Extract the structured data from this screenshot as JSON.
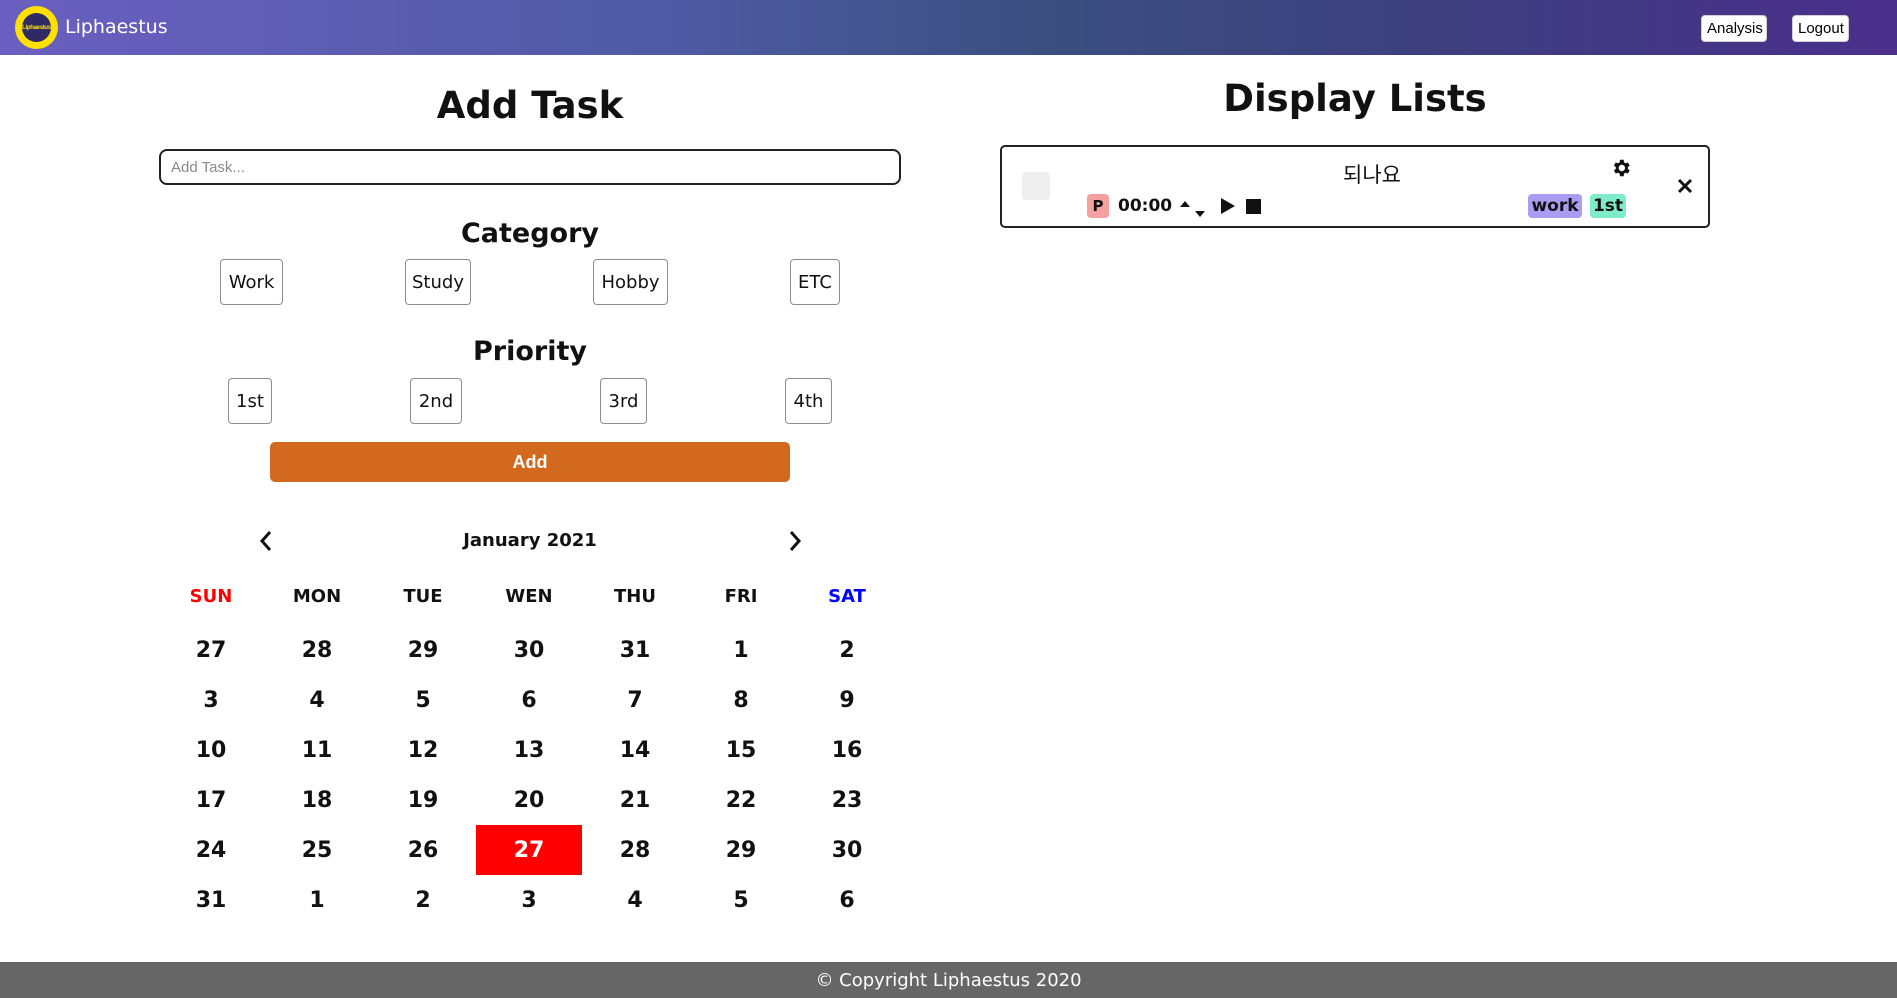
{
  "header": {
    "logo_text": "Liphaestus",
    "brand": "Liphaestus",
    "analysis_label": "Analysis",
    "logout_label": "Logout"
  },
  "add_task": {
    "title": "Add Task",
    "input_placeholder": "Add Task...",
    "input_value": "",
    "category_title": "Category",
    "categories": [
      "Work",
      "Study",
      "Hobby",
      "ETC"
    ],
    "priority_title": "Priority",
    "priorities": [
      "1st",
      "2nd",
      "3rd",
      "4th"
    ],
    "add_label": "Add"
  },
  "calendar": {
    "month_label": "January 2021",
    "prev_icon": "chevron-left-icon",
    "next_icon": "chevron-right-icon",
    "weekdays": [
      "SUN",
      "MON",
      "TUE",
      "WEN",
      "THU",
      "FRI",
      "SAT"
    ],
    "weekday_colors": {
      "SUN": "#ff0000",
      "SAT": "#0000ff",
      "default": "#111111"
    },
    "weeks": [
      [
        "27",
        "28",
        "29",
        "30",
        "31",
        "1",
        "2"
      ],
      [
        "3",
        "4",
        "5",
        "6",
        "7",
        "8",
        "9"
      ],
      [
        "10",
        "11",
        "12",
        "13",
        "14",
        "15",
        "16"
      ],
      [
        "17",
        "18",
        "19",
        "20",
        "21",
        "22",
        "23"
      ],
      [
        "24",
        "25",
        "26",
        "27",
        "28",
        "29",
        "30"
      ],
      [
        "31",
        "1",
        "2",
        "3",
        "4",
        "5",
        "6"
      ]
    ],
    "selected": {
      "week": 4,
      "day": 3
    },
    "selected_color": "#ff0000"
  },
  "display_lists": {
    "title": "Display Lists",
    "tasks": [
      {
        "title": "되나요",
        "done": false,
        "p_badge": "P",
        "timer": "00:00",
        "category_tag": "work",
        "priority_tag": "1st",
        "category_color": "#a99cf2",
        "priority_color": "#7eecc9"
      }
    ]
  },
  "footer": {
    "text": "© Copyright Liphaestus 2020"
  },
  "colors": {
    "add_button": "#d2691e",
    "footer_bg": "#666666",
    "p_badge": "#f4a0a0"
  }
}
